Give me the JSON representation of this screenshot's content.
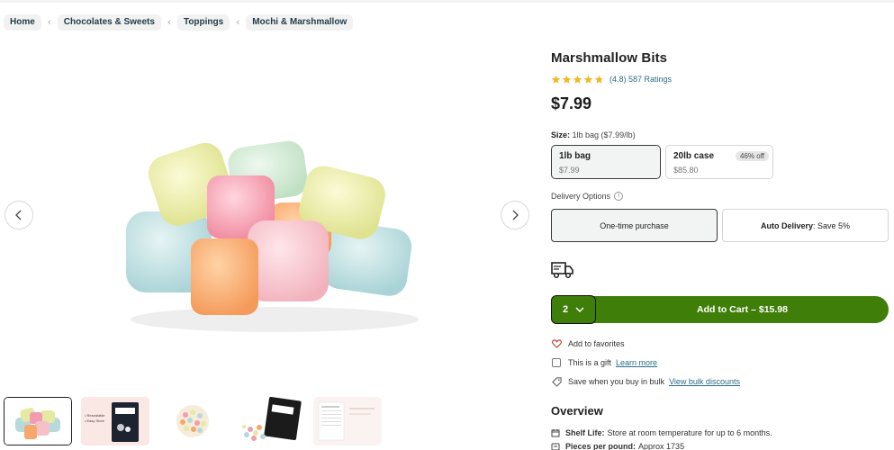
{
  "breadcrumb": [
    "Home",
    "Chocolates & Sweets",
    "Toppings",
    "Mochi & Marshmallow"
  ],
  "product": {
    "title": "Marshmallow Bits",
    "rating_value": 4.8,
    "rating_text": "(4.8) 587 Ratings",
    "price": "$7.99"
  },
  "size": {
    "label_prefix": "Size:",
    "label_value": "1lb bag ($7.99/lb)",
    "options": [
      {
        "name": "1lb bag",
        "price": "$7.99",
        "selected": true
      },
      {
        "name": "20lb case",
        "price": "$85.80",
        "badge": "46% off",
        "selected": false
      }
    ]
  },
  "delivery": {
    "label": "Delivery Options",
    "info_icon": "i",
    "options": [
      {
        "label": "One-time purchase",
        "selected": true
      },
      {
        "label_bold": "Auto Delivery",
        "label_rest": ": Save 5%",
        "selected": false
      }
    ]
  },
  "cart": {
    "quantity": "2",
    "add_label": "Add to Cart – $15.98",
    "accent": "#3f7e09"
  },
  "extras": {
    "favorites": "Add to favorites",
    "gift": "This is a gift",
    "gift_link": "Learn more",
    "bulk": "Save when you buy in bulk",
    "bulk_link": "View bulk discounts"
  },
  "overview": {
    "title": "Overview",
    "shelf_label": "Shelf Life:",
    "shelf_text": "Store at room temperature for up to 6 months.",
    "pieces_label": "Pieces per pound:",
    "pieces_text": "Approx 1735"
  },
  "thumbnails": {
    "thumb2_text": "• Resealable\n• Noto.Nuts",
    "brand": "Nuts.com"
  },
  "icons": [
    "chevron-left-icon",
    "chevron-right-icon",
    "star-icon",
    "info-icon",
    "truck-icon",
    "chevron-down-icon",
    "heart-icon",
    "checkbox-icon",
    "tag-icon",
    "calendar-icon",
    "scale-icon"
  ]
}
